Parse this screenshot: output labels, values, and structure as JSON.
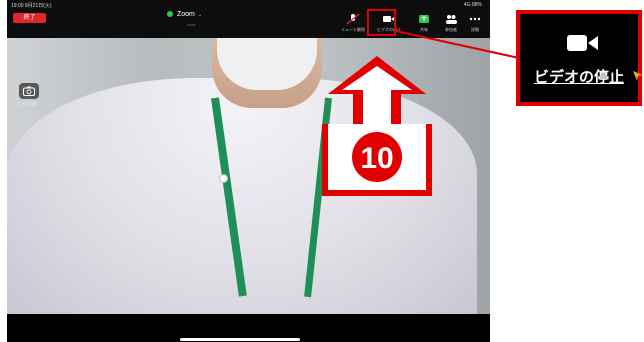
{
  "status_bar": {
    "time": "19:00 9月21日(火)",
    "right": "4G 88%"
  },
  "toolbar": {
    "end_label": "終了",
    "title": "Zoom",
    "subtitle": "••••••",
    "items": [
      {
        "label": "ミュート解除",
        "icon": "microphone-muted-icon"
      },
      {
        "label": "ビデオの停止",
        "icon": "video-camera-icon"
      },
      {
        "label": "共有",
        "icon": "share-screen-icon"
      },
      {
        "label": "参加者",
        "icon": "participants-icon"
      },
      {
        "label": "詳細",
        "icon": "more-icon"
      }
    ]
  },
  "video": {
    "camera_switch_label": "カメラ切替"
  },
  "annotation": {
    "step_number": "10",
    "callout_label": "ビデオの停止",
    "accent_color": "#e00000"
  }
}
